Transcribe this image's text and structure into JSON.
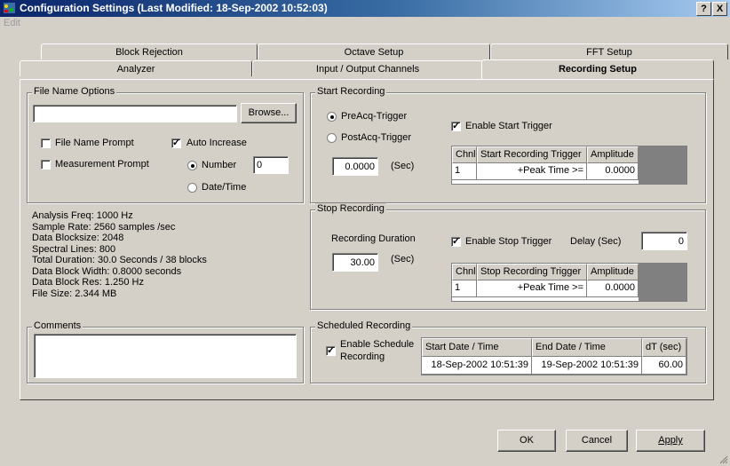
{
  "window": {
    "title": "Configuration Settings  (Last Modified: 18-Sep-2002 10:52:03)",
    "help_button": "?",
    "close_button": "X"
  },
  "menu": {
    "edit": "Edit"
  },
  "tabs": {
    "row_back": [
      "Block Rejection",
      "Octave Setup",
      "FFT Setup"
    ],
    "row_front": [
      "Analyzer",
      "Input / Output Channels",
      "Recording Setup"
    ],
    "active": "Recording Setup"
  },
  "file_name_options": {
    "title": "File Name Options",
    "filename_value": "",
    "browse_label": "Browse...",
    "file_name_prompt": {
      "label": "File Name Prompt",
      "checked": false
    },
    "measurement_prompt": {
      "label": "Measurement Prompt",
      "checked": false
    },
    "auto_increase": {
      "label": "Auto Increase",
      "checked": true
    },
    "number": {
      "label": "Number",
      "selected": true,
      "value": "0"
    },
    "datetime": {
      "label": "Date/Time",
      "selected": false
    }
  },
  "info": [
    "Analysis Freq:  1000 Hz",
    "Sample Rate:   2560 samples /sec",
    "Data Blocksize:  2048",
    "Spectral Lines:  800",
    "Total Duration:  30.0 Seconds  /  38 blocks",
    "Data Block Width: 0.8000 seconds",
    "Data Block Res:  1.250 Hz",
    "File Size:     2.344 MB"
  ],
  "comments": {
    "title": "Comments",
    "value": ""
  },
  "start_recording": {
    "title": "Start Recording",
    "preacq": {
      "label": "PreAcq-Trigger",
      "selected": true
    },
    "postacq": {
      "label": "PostAcq-Trigger",
      "selected": false
    },
    "time_value": "0.0000",
    "unit": "(Sec)",
    "enable_label": "Enable Start Trigger",
    "enable_checked": true,
    "table": {
      "headers": [
        "Chnl",
        "Start Recording Trigger",
        "Amplitude"
      ],
      "rows": [
        [
          "1",
          "+Peak Time >=",
          "0.0000"
        ]
      ]
    }
  },
  "stop_recording": {
    "title": "Stop Recording",
    "duration_label": "Recording Duration",
    "duration_value": "30.00",
    "unit": "(Sec)",
    "enable_label": "Enable Stop Trigger",
    "enable_checked": true,
    "delay_label": "Delay (Sec)",
    "delay_value": "0",
    "table": {
      "headers": [
        "Chnl",
        "Stop Recording Trigger",
        "Amplitude"
      ],
      "rows": [
        [
          "1",
          "+Peak Time >=",
          "0.0000"
        ]
      ]
    }
  },
  "scheduled_recording": {
    "title": "Scheduled Recording",
    "enable_line1": "Enable Schedule",
    "enable_line2": "Recording",
    "enable_checked": true,
    "table": {
      "headers": [
        "Start Date / Time",
        "End Date / Time",
        "dT (sec)"
      ],
      "rows": [
        [
          "18-Sep-2002 10:51:39",
          "19-Sep-2002 10:51:39",
          "60.00"
        ]
      ]
    }
  },
  "buttons": {
    "ok": "OK",
    "cancel": "Cancel",
    "apply": "Apply"
  }
}
